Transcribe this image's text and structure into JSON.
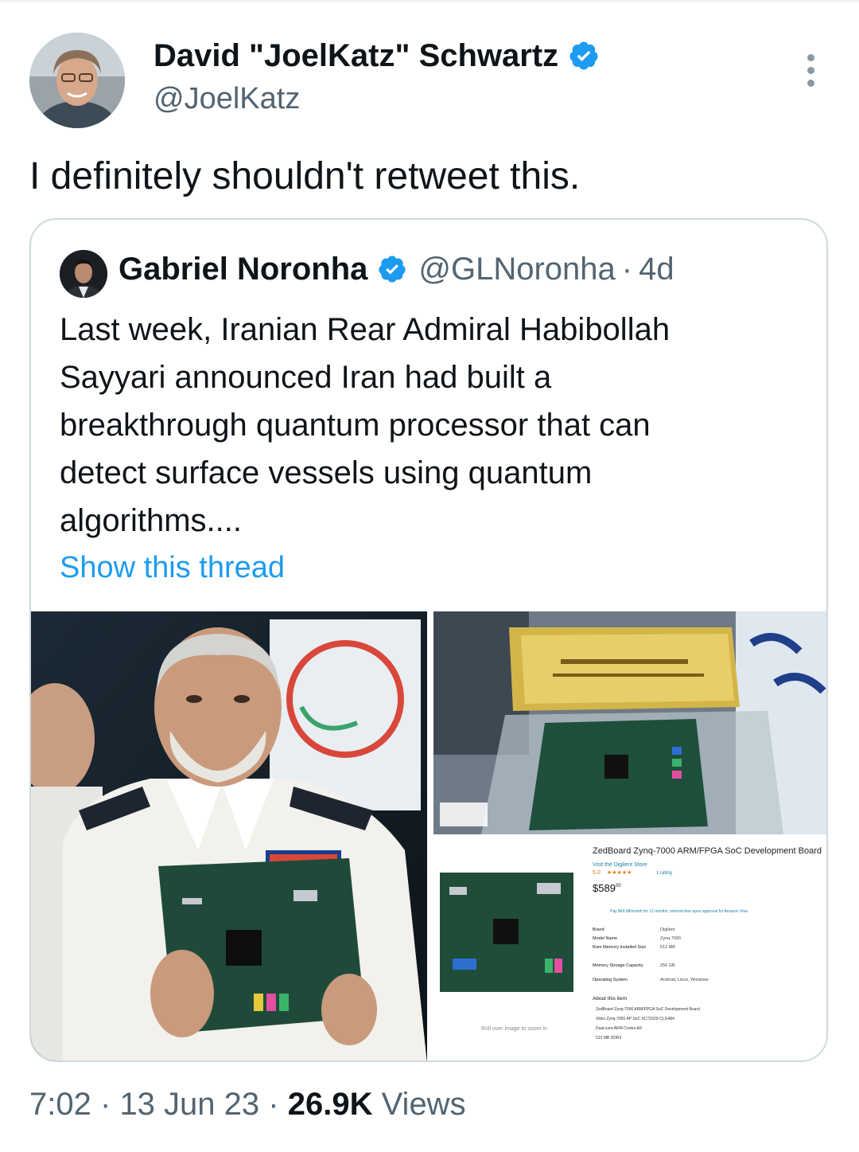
{
  "tweet": {
    "author_name": "David \"JoelKatz\" Schwartz",
    "author_handle": "@JoelKatz",
    "text": "I definitely shouldn't retweet this.",
    "time": "7:02",
    "date": "13 Jun 23",
    "views_count": "26.9K",
    "views_label": "Views",
    "separator": "·"
  },
  "quoted": {
    "author_name": "Gabriel Noronha",
    "author_handle": "@GLNoronha",
    "age": "4d",
    "separator": "·",
    "text_lines": [
      "Last week, Iranian Rear Admiral Habibollah",
      "Sayyari announced Iran had built a",
      "breakthrough quantum processor that can",
      "detect surface vessels using quantum",
      "algorithms...."
    ],
    "show_thread": "Show this thread"
  },
  "product_listing": {
    "title": "ZedBoard Zynq-7000 ARM/FPGA SoC Development Board",
    "store": "Visit the Digilent Store",
    "rating": "5.0",
    "ratings_count": "1 rating",
    "price": "$589",
    "price_cents": "00",
    "financing": "Pay $49.08/month for 12 months, interest-free upon approval for Amazon Visa",
    "specs": [
      {
        "label": "Brand",
        "value": "Digilent"
      },
      {
        "label": "Model Name",
        "value": "Zynq 7000"
      },
      {
        "label": "Ram Memory Installed Size",
        "value": "512 MB"
      },
      {
        "label": "Memory Storage Capacity",
        "value": "256 GB"
      },
      {
        "label": "Operating System",
        "value": "Android, Linux, Windows"
      }
    ],
    "about_heading": "About this item",
    "bullets": [
      "ZedBoard Zynq-7000 ARM/FPGA SoC Development Board",
      "Xilinx Zynq-7000 AP SoC XC7Z020-CLG484",
      "Dual-core ARM Cortex-A9",
      "512 MB DDR3"
    ],
    "zoom_hint": "Roll over image to zoom in"
  },
  "colors": {
    "text": "#0f1419",
    "secondary": "#536471",
    "link": "#1d9bf0",
    "verified": "#1d9bf0",
    "border": "#cfd9de"
  }
}
